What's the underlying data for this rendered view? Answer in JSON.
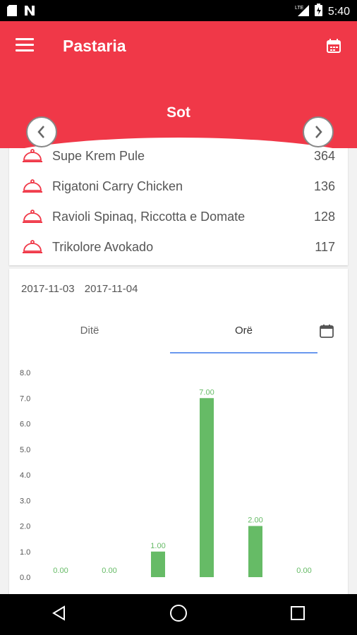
{
  "status_bar": {
    "time": "5:40",
    "network": "LTE"
  },
  "header": {
    "title": "Pastaria",
    "period_label": "Sot"
  },
  "colors": {
    "accent": "#f03848",
    "bar": "#66bb66",
    "tab_underline": "#6a98ee"
  },
  "products": [
    {
      "name": "Supe Krem Pule",
      "count": "364"
    },
    {
      "name": "Rigatoni Carry Chicken",
      "count": "136"
    },
    {
      "name": "Ravioli Spinaq, Riccotta e Domate",
      "count": "128"
    },
    {
      "name": "Trikolore  Avokado",
      "count": "117"
    }
  ],
  "date_range": {
    "start": "2017-11-03",
    "end": "2017-11-04"
  },
  "tabs": [
    {
      "label": "Ditë",
      "active": false
    },
    {
      "label": "Orë",
      "active": true
    }
  ],
  "chart_data": {
    "type": "bar",
    "title": "",
    "xlabel": "",
    "ylabel": "",
    "ylim": [
      0,
      8
    ],
    "yticks": [
      "0.0",
      "1.0",
      "2.0",
      "3.0",
      "4.0",
      "5.0",
      "6.0",
      "7.0",
      "8.0"
    ],
    "values": [
      0,
      0,
      1,
      7,
      2,
      0
    ],
    "value_labels": [
      "0.00",
      "0.00",
      "1.00",
      "7.00",
      "2.00",
      "0.00"
    ],
    "grid": false
  }
}
